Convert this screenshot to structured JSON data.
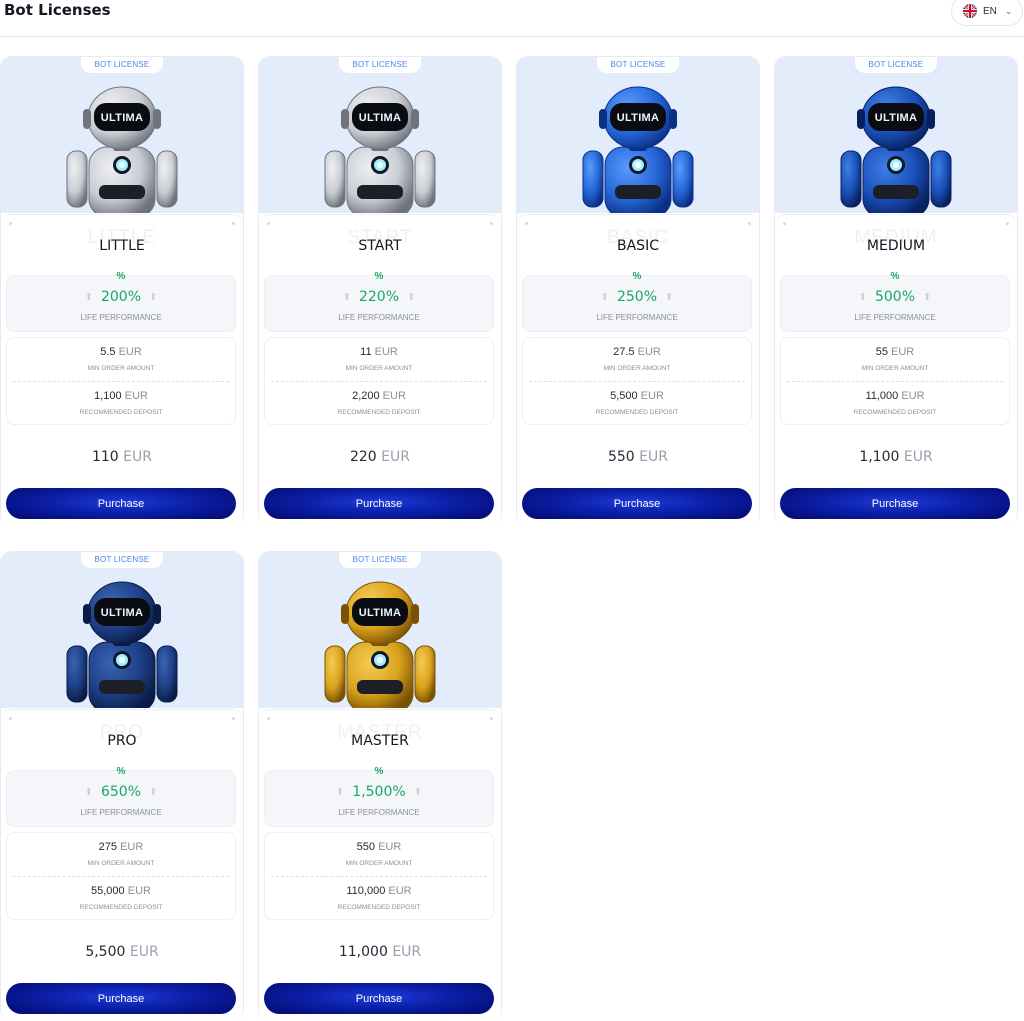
{
  "header": {
    "title": "Bot Licenses",
    "language": "EN",
    "language_icon": "uk-flag-icon"
  },
  "colors": {
    "accent_green": "#1aa866",
    "button_dark": "#04096a",
    "button_light": "#1f3ad8",
    "hero_bg": "#e3ecfb",
    "badge_text": "#4a86e8"
  },
  "labels": {
    "badge": "BOT LICENSE",
    "robot_screen": "ULTIMA",
    "percent_symbol": "%",
    "life_performance": "LIFE PERFORMANCE",
    "min_order": "MIN ORDER AMOUNT",
    "recommended_deposit": "RECOMMENDED DEPOSIT",
    "currency": "EUR",
    "purchase": "Purchase"
  },
  "licenses": [
    {
      "name": "LITTLE",
      "robot_color": "silver",
      "performance": "200%",
      "min_order": "5.5",
      "deposit": "1,100",
      "price": "110"
    },
    {
      "name": "START",
      "robot_color": "silver",
      "performance": "220%",
      "min_order": "11",
      "deposit": "2,200",
      "price": "220"
    },
    {
      "name": "BASIC",
      "robot_color": "blue",
      "performance": "250%",
      "min_order": "27.5",
      "deposit": "5,500",
      "price": "550"
    },
    {
      "name": "MEDIUM",
      "robot_color": "royal-blue",
      "performance": "500%",
      "min_order": "55",
      "deposit": "11,000",
      "price": "1,100"
    },
    {
      "name": "PRO",
      "robot_color": "navy",
      "performance": "650%",
      "min_order": "275",
      "deposit": "55,000",
      "price": "5,500"
    },
    {
      "name": "MASTER",
      "robot_color": "gold",
      "performance": "1,500%",
      "min_order": "550",
      "deposit": "110,000",
      "price": "11,000"
    }
  ]
}
